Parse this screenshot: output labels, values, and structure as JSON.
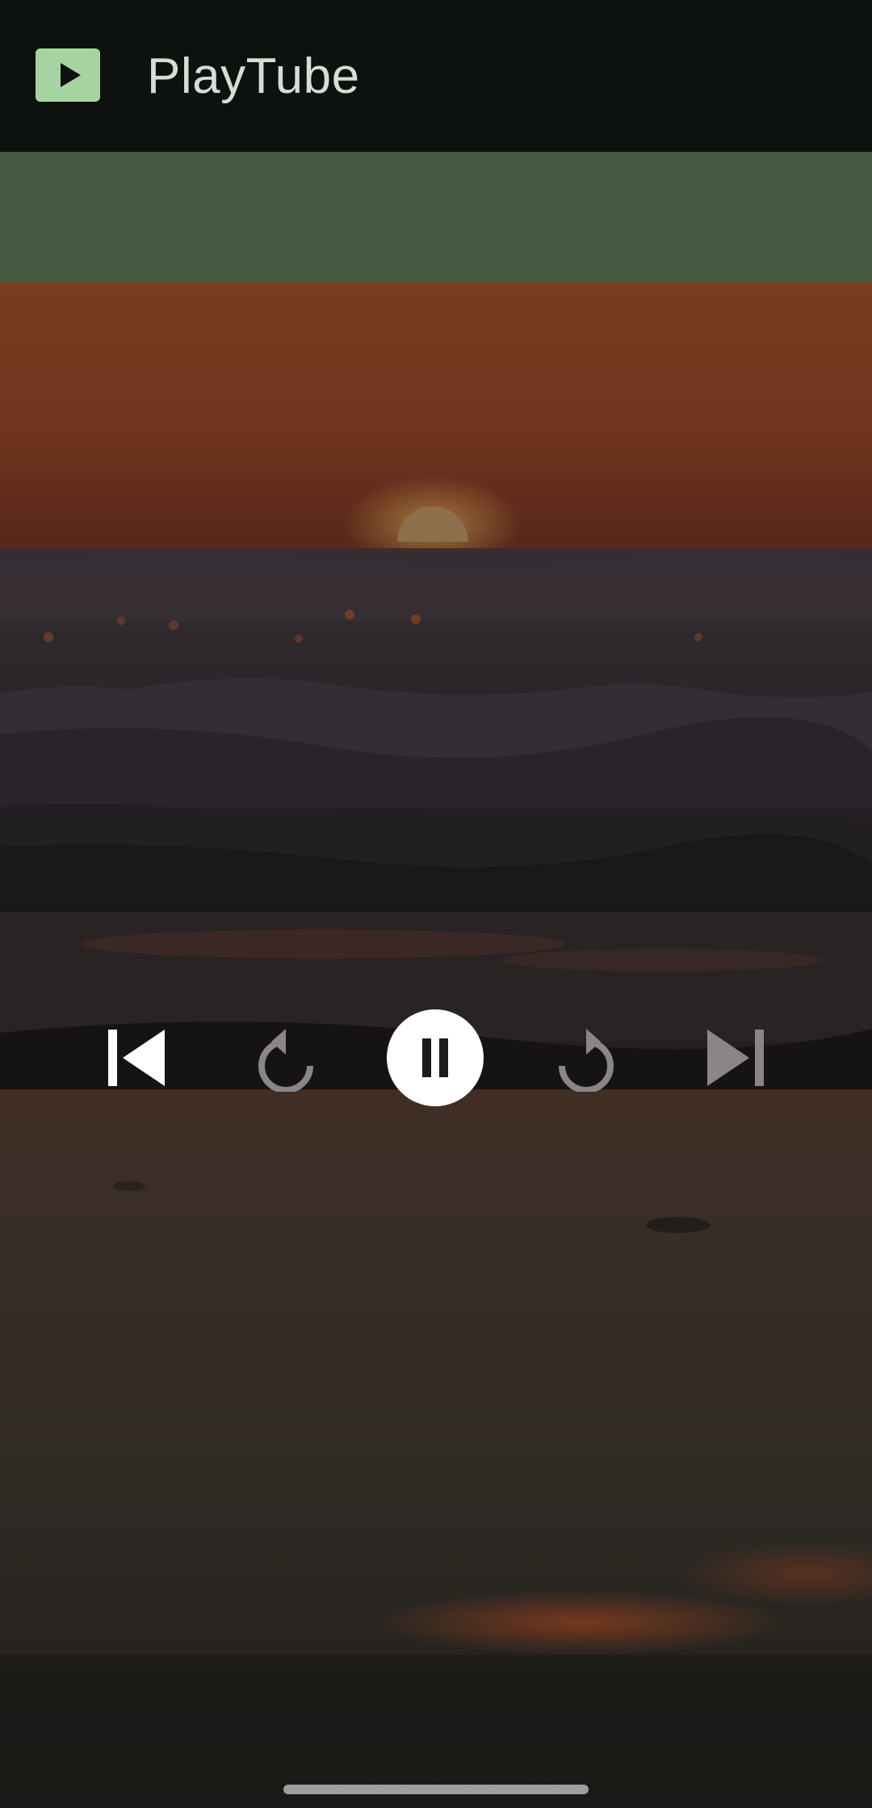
{
  "app_bar": {
    "title": "PlayTube",
    "logo_icon": "play-logo-icon",
    "logo_color": "#a6d4a0",
    "background": "#0d120e"
  },
  "banner": {
    "color": "#455a40"
  },
  "player": {
    "state": "playing",
    "controls": [
      {
        "name": "previous",
        "icon": "skip-previous-icon",
        "enabled": true
      },
      {
        "name": "rewind",
        "icon": "replay-icon",
        "enabled": false
      },
      {
        "name": "pause",
        "icon": "pause-icon",
        "enabled": true
      },
      {
        "name": "forward",
        "icon": "forward-icon",
        "enabled": false
      },
      {
        "name": "next",
        "icon": "skip-next-icon",
        "enabled": false
      }
    ]
  },
  "system": {
    "gesture_bar": "home-gesture-handle"
  }
}
